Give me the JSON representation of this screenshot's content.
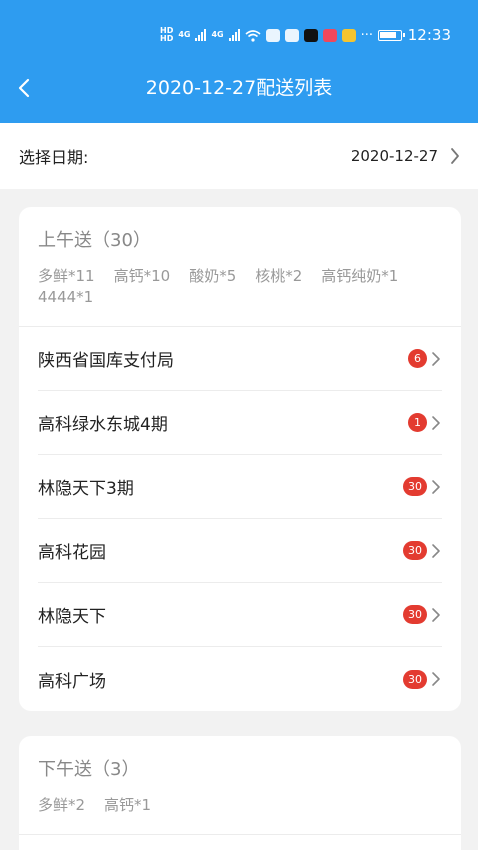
{
  "status_bar": {
    "time": "12:33",
    "hd1": "HD",
    "hd2": "HD",
    "net1": "4G",
    "net2": "4G",
    "more": "···"
  },
  "header": {
    "title": "2020-12-27配送列表"
  },
  "date_selector": {
    "label": "选择日期:",
    "value": "2020-12-27"
  },
  "morning": {
    "title": "上午送（30）",
    "summary": [
      "多鲜*11",
      "高钙*10",
      "酸奶*5",
      "核桃*2",
      "高钙纯奶*1",
      "4444*1"
    ],
    "rows": [
      {
        "name": "陕西省国库支付局",
        "count": "6"
      },
      {
        "name": "高科绿水东城4期",
        "count": "1"
      },
      {
        "name": "林隐天下3期",
        "count": "30"
      },
      {
        "name": "高科花园",
        "count": "30"
      },
      {
        "name": "林隐天下",
        "count": "30"
      },
      {
        "name": "高科广场",
        "count": "30"
      }
    ]
  },
  "afternoon": {
    "title": "下午送（3）",
    "summary": [
      "多鲜*2",
      "高钙*1"
    ]
  }
}
